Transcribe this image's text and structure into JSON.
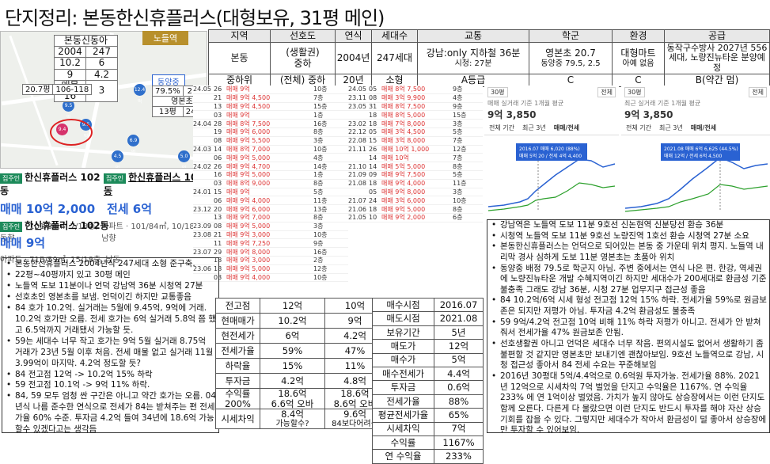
{
  "title": "단지정리: 본동한신휴플러스(대형보유, 31평 메인)",
  "main_table": {
    "headers": [
      "지역",
      "선호도",
      "연식",
      "세대수",
      "교통",
      "학군",
      "환경",
      "공급"
    ],
    "row1": [
      "본동",
      "(생활권)\n중하",
      "2004년",
      "247세대",
      "강남:only 지하철 36분",
      "영본초 20.7",
      "대형마트",
      "동작구수방사 2027년 556"
    ],
    "row1_sub": {
      "transit": "시청: 27분",
      "school": "동양중 79.5, 2.5",
      "env": "아예 없음",
      "supply": "세대, 노량진뉴타운 분양예정"
    },
    "row2": [
      "중하위",
      "(전체) 중하",
      "20년",
      "소형",
      "A등급",
      "C",
      "C",
      "B(약간 멈)"
    ]
  },
  "map": {
    "station_tag": "노들역",
    "table1": {
      "title": "본동신동아",
      "rows": [
        [
          "2004",
          "247"
        ],
        [
          "10.2",
          "6"
        ],
        [
          "9",
          "4.2"
        ],
        [
          "매물 16",
          "3"
        ]
      ]
    },
    "table2": {
      "rows": [
        [
          "20.7평",
          "106-118"
        ]
      ]
    },
    "school_tag": "동양중",
    "table3": {
      "rows": [
        [
          "79.5%",
          "2.5%"
        ],
        [
          "영본초",
          ""
        ],
        [
          "13평",
          "24-13"
        ]
      ]
    }
  },
  "listings": [
    {
      "badge": "집주인",
      "name": "한신휴플러스 102동",
      "price1": "매매 10억 2,000",
      "price2": "전세 6억",
      "sub1": "아파트 · 101/84㎡, 7/18층, 동향",
      "sub2": "아파트 · 101/84㎡, 10/18층, 남향"
    },
    {
      "badge": "집주인",
      "name": "한신휴플러스 102동",
      "price1": "매매 9억",
      "sub1": "아파트 · 71B/59㎡, 15/18층, 남동"
    }
  ],
  "left_notes": [
    "본동한신휴플러스 2004년식 247세대 소형 준구축.",
    "22평~40평까지 있고 30평 메인",
    "노들역 도보 11분이나 언덕 강남역 36분 시청역 27분",
    "선호초인 영본초를 보냄. 언덕이긴 하지만 교통좋음",
    "84 호가 10.2억. 실거래는 5월에 9.45억, 9억에 거래. 10.2억 호가만 오름. 전세 호가는 6억 실거래 5.8억 쯤 했고 6.5억까지 거래됐서 가능할 듯.",
    "59는 세대수 너무 작고 호가는 9억 5월 실거래 8.75억 거래가 23년 5월 이후 처음. 전세 매물 없고 실거래 11월 3.99억이 마지막. 4.2억 정도할 듯?",
    "84 전고점 12억 -> 10.2억 15% 하락",
    "59 전고점 10.1억 -> 9억 11% 하락.",
    "84, 59 모두 엄청 싼 구간은 아니고 약간 호가는 오름. 04년식 나름 준수한 연식으로 전세가 84는 받쳐주는 편 전세가율 60% 수준. 투자금 4.2억 들여 34년에 18.6억 가능할수 있겠다고는 생각듬",
    "저평가X,환금성X(200세대), 수익성세모?(환금보통)"
  ],
  "calc1": {
    "headers": [
      "",
      "84",
      "59"
    ],
    "rows": [
      [
        "전고점",
        "12억",
        "10억"
      ],
      [
        "현매매가",
        "10.2억",
        "9억"
      ],
      [
        "현전세가",
        "6억",
        "4.2억"
      ],
      [
        "전세가율",
        "59%",
        "47%"
      ],
      [
        "하락율",
        "15%",
        "11%"
      ],
      [
        "투자금",
        "4.2억",
        "4.8억"
      ],
      [
        "수익률",
        "18.6억",
        "18.6억"
      ],
      [
        "수익률_sub",
        "200%",
        "6.6억 오바",
        "8.6억 오바"
      ],
      [
        "시세차익",
        "8.4억",
        "9.6억"
      ],
      [
        "시세차익_sub",
        "",
        "가능할수?",
        "84보다어려움"
      ]
    ]
  },
  "calc2": {
    "rows": [
      [
        "매수시점",
        "2016.07"
      ],
      [
        "매도시점",
        "2021.08"
      ],
      [
        "보유기간",
        "5년"
      ],
      [
        "매도가",
        "12억"
      ],
      [
        "매수가",
        "5억"
      ],
      [
        "매수전세가",
        "4.4억"
      ],
      [
        "투자금",
        "0.6억"
      ],
      [
        "전세가율",
        "88%"
      ],
      [
        "평균전세가율",
        "65%"
      ],
      [
        "시세차익",
        "7억"
      ],
      [
        "수익률",
        "1167%"
      ],
      [
        "연 수익율",
        "233%"
      ]
    ]
  },
  "right_notes": [
    "강남역은 노들역 도보 11분 9호선 신논현역 신분당선 환승 36분",
    "시청역 노들역 도보 11분 9호선 노량진역 1호선 환승 시청역 27분 소요",
    "본동한신휴플러스는 언덕으로 되어있는 본동 중 가운데 위치 평지. 노들역 내리막 경사 심하게 도보 11분 영본초는 초품아 위치",
    "동양중 배정 79.5로 학군지 아님. 주변 중에서는 연식 나은 편. 한강, 역세권에 노량진뉴타운 개발 수혜지역이긴 하지만 세대수가 200세대로 환금성 기준 불충족 그래도 강남 36분, 시청 27분 업무지구 접근성 좋음",
    "84 10.2억/6억 시세 형성 전고점 12억 15% 하락. 전세가율 59%로 원금보존은 되지만 저평가 아님. 투자금 4.2억 환금성도 불충족",
    "59 9억/4.2억 전고점 10억 비해 11% 하락 저평가 아니고. 전세가 안 받쳐줘서 전세가율 47% 원금보존 안됨.",
    "선호생활권 아니고 언덕은 세대수 너무 작음. 편의시설도 없어서 생활하기 좀 불편할 것 같지만 영본초만 보내기엔 괜찮아보임. 9호선 노들역으로 강남, 시청 접근성 좋아서 84 전세 수요는 꾸준해보임",
    "2016년 30평대 5억/4.4억으로 0.6억원 투자가능. 전세가율 88%. 2021년 12억으로 시세차익 7억 벌었을 단지고 수익율은 1167%. 연 수익율 233% 에 연 1억이상 벌었음. 가치가 높지 않아도 상승장에서는 이런 단지도 함께 오른다. 다른게 다 물랐으면 이런 단지도 반드시 투자를 해야 자산 상승 기회를 잡을 수 있다. 그렇지만 세대수가 작아서 환금성이 덜 좋아서 상승장에만 투자할 수 있어보임."
  ],
  "trades_a": [
    [
      "24.05",
      "26",
      "매매 9억",
      "10층"
    ],
    [
      "",
      "21",
      "매매 9억 4,500",
      "7층"
    ],
    [
      "",
      "13",
      "매매 9억 4,500",
      "15층"
    ],
    [
      "",
      "03",
      "매매 9억",
      "1층"
    ],
    [
      "24.04",
      "28",
      "매매 8억 7,500",
      "16층"
    ],
    [
      "",
      "19",
      "매매 9억 6,000",
      "8층"
    ],
    [
      "",
      "08",
      "매매 9억 5,500",
      "3층"
    ],
    [
      "24.03",
      "14",
      "매매 8억 7,000",
      "10층"
    ],
    [
      "",
      "06",
      "매매 9억 5,000",
      "4층"
    ],
    [
      "24.02",
      "26",
      "매매 9억 4,700",
      "14층"
    ],
    [
      "",
      "16",
      "매매 9억 5,000",
      "1층"
    ],
    [
      "",
      "03",
      "매매 8억 9,000",
      "8층"
    ],
    [
      "24.01",
      "15",
      "매매 9억",
      "5층"
    ],
    [
      "",
      "06",
      "매매 9억 4,000",
      "11층"
    ],
    [
      "23.12",
      "20",
      "매매 9억 6,000",
      "13층"
    ],
    [
      "",
      "13",
      "매매 9억 7,000",
      "8층"
    ],
    [
      "23.09",
      "08",
      "매매 9억 5,000",
      "3층"
    ],
    [
      "23.08",
      "21",
      "매매 9억 3,000",
      "10층"
    ],
    [
      "",
      "11",
      "매매 9억 7,250",
      "9층"
    ],
    [
      "23.07",
      "29",
      "매매 9억 8,000",
      "16층"
    ],
    [
      "",
      "18",
      "매매 9억 3,000",
      "2층"
    ],
    [
      "23.06",
      "18",
      "매매 9억 5,000",
      "12층"
    ],
    [
      "",
      "03",
      "매매 9억 4,000",
      "10층"
    ]
  ],
  "trades_b": [
    [
      "24.05",
      "05",
      "매매 8억 7,500",
      "9층"
    ],
    [
      "23.11",
      "08",
      "매매 3억 9,900",
      "4층"
    ],
    [
      "23.05",
      "31",
      "매매 8억 7,500",
      "9층"
    ],
    [
      "",
      "18",
      "매매 8억 5,000",
      "15층"
    ],
    [
      "23.02",
      "18",
      "매매 7억 8,000",
      "3층"
    ],
    [
      "22.12",
      "05",
      "매매 3억 4,500",
      "5층"
    ],
    [
      "22.08",
      "15",
      "매매 3억 8,000",
      "7층"
    ],
    [
      "21.11",
      "26",
      "매매 10억 1,000",
      "12층"
    ],
    [
      "",
      "14",
      "매매 10억",
      "7층"
    ],
    [
      "21.10",
      "14",
      "매매 5억 5,000",
      "8층"
    ],
    [
      "21.09",
      "09",
      "매매 9억 7,500",
      "5층"
    ],
    [
      "21.08",
      "18",
      "매매 9억 4,000",
      "11층"
    ],
    [
      "",
      "05",
      "매매 9억 8,000",
      "3층"
    ],
    [
      "21.07",
      "24",
      "매매 3억 6,000",
      "10층"
    ],
    [
      "21.06",
      "18",
      "매매 9억 5,000",
      "8층"
    ],
    [
      "21.05",
      "10",
      "매매 9억 2,000",
      "6층"
    ]
  ],
  "chart_left": {
    "header_left": "30평",
    "header_right": "전체",
    "price_label": "매매 실거래 기준 1개월 평균",
    "price": "9억 3,850",
    "tabs": [
      "전체 기간",
      "최근 3년",
      "매매/전세"
    ],
    "annotation": "2016.07 매매 6,020 (88%)",
    "annotation2": "매매 5억 20 / 전세 4억 4,400"
  },
  "chart_right": {
    "header_left": "30평",
    "header_right": "전체",
    "price_label": "최근 실거래 기준 1개월 평균",
    "price": "9억 3,850",
    "tabs": [
      "전체 기간",
      "최근 3년",
      "매매/전세"
    ],
    "annotation": "2021.08 매매 6억 6,625 (44.5%)",
    "annotation2": "매매 12억 / 전세 6억 4,500"
  }
}
